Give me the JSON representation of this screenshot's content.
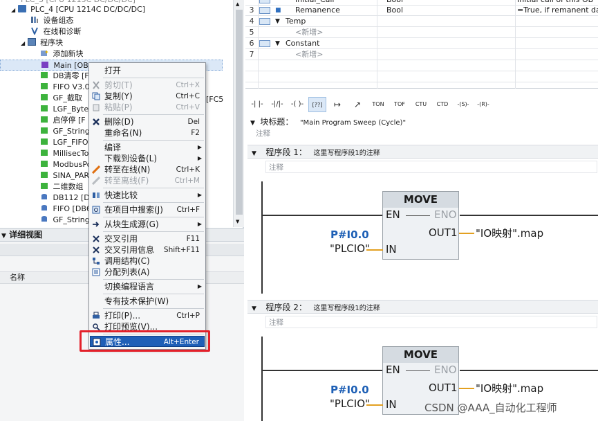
{
  "tree": {
    "items": [
      {
        "label": "PLC_4 [CPU 1214C DC/DC/DC]"
      },
      {
        "label": "设备组态"
      },
      {
        "label": "在线和诊断"
      },
      {
        "label": "程序块"
      },
      {
        "label": "添加新块"
      },
      {
        "label": "Main [OB1]"
      },
      {
        "label": "DB清零 [F"
      },
      {
        "label": "FIFO V3.0"
      },
      {
        "label": "GF_截取"
      },
      {
        "label": "LGF_Byte_"
      },
      {
        "label": "启停停 [F"
      },
      {
        "label": "GF_String_"
      },
      {
        "label": "LGF_FIFO"
      },
      {
        "label": "MillisecTo"
      },
      {
        "label": "ModbusPo"
      },
      {
        "label": "SINA_PARA"
      },
      {
        "label": "二维数组"
      },
      {
        "label": "DB112 [DB"
      },
      {
        "label": "FIFO [DB6"
      },
      {
        "label": "GF_String"
      }
    ],
    "partial_right": "[FC5"
  },
  "detail_view": {
    "title": "详细视图",
    "column_name": "名称"
  },
  "context_menu": {
    "items": [
      {
        "label": "打开",
        "shortcut": "",
        "icon": "none",
        "disabled": false,
        "submenu": false
      },
      {
        "label": "剪切(T)",
        "shortcut": "Ctrl+X",
        "icon": "cut-icon",
        "disabled": true,
        "submenu": false
      },
      {
        "label": "复制(Y)",
        "shortcut": "Ctrl+C",
        "icon": "copy-icon",
        "disabled": false,
        "submenu": false
      },
      {
        "label": "粘贴(P)",
        "shortcut": "Ctrl+V",
        "icon": "paste-icon",
        "disabled": true,
        "submenu": false
      },
      {
        "label": "删除(D)",
        "shortcut": "Del",
        "icon": "delete-icon",
        "disabled": false,
        "submenu": false
      },
      {
        "label": "重命名(N)",
        "shortcut": "F2",
        "icon": "none",
        "disabled": false,
        "submenu": false
      },
      {
        "label": "编译",
        "shortcut": "",
        "icon": "none",
        "disabled": false,
        "submenu": true
      },
      {
        "label": "下载到设备(L)",
        "shortcut": "",
        "icon": "none",
        "disabled": false,
        "submenu": true
      },
      {
        "label": "转至在线(N)",
        "shortcut": "Ctrl+K",
        "icon": "go-online-icon",
        "disabled": false,
        "submenu": false
      },
      {
        "label": "转至离线(F)",
        "shortcut": "Ctrl+M",
        "icon": "go-offline-icon",
        "disabled": true,
        "submenu": false
      },
      {
        "label": "快速比较",
        "shortcut": "",
        "icon": "compare-icon",
        "disabled": false,
        "submenu": true
      },
      {
        "label": "在项目中搜索(J)",
        "shortcut": "Ctrl+F",
        "icon": "search-icon",
        "disabled": false,
        "submenu": false
      },
      {
        "label": "从块生成源(G)",
        "shortcut": "",
        "icon": "generate-source-icon",
        "disabled": false,
        "submenu": true
      },
      {
        "label": "交叉引用",
        "shortcut": "F11",
        "icon": "cross-reference-icon",
        "disabled": false,
        "submenu": false
      },
      {
        "label": "交叉引用信息",
        "shortcut": "Shift+F11",
        "icon": "cross-reference-info-icon",
        "disabled": false,
        "submenu": false
      },
      {
        "label": "调用结构(C)",
        "shortcut": "",
        "icon": "call-structure-icon",
        "disabled": false,
        "submenu": false
      },
      {
        "label": "分配列表(A)",
        "shortcut": "",
        "icon": "assignment-list-icon",
        "disabled": false,
        "submenu": false
      },
      {
        "label": "切换编程语言",
        "shortcut": "",
        "icon": "none",
        "disabled": false,
        "submenu": true
      },
      {
        "label": "专有技术保护(W)",
        "shortcut": "",
        "icon": "none",
        "disabled": false,
        "submenu": false
      },
      {
        "label": "打印(P)...",
        "shortcut": "Ctrl+P",
        "icon": "print-icon",
        "disabled": false,
        "submenu": false
      },
      {
        "label": "打印预览(V)...",
        "shortcut": "",
        "icon": "print-preview-icon",
        "disabled": false,
        "submenu": false
      },
      {
        "label": "属性...",
        "shortcut": "Alt+Enter",
        "icon": "properties-icon",
        "disabled": false,
        "submenu": false,
        "highlighted": true
      }
    ]
  },
  "interface_table": {
    "rows": [
      {
        "no": "",
        "name": "Initial_Call",
        "type": "Bool",
        "comment": "Initial call of this OB"
      },
      {
        "no": "3",
        "name": "Remanence",
        "type": "Bool",
        "comment": "=True, if remanent data ar"
      },
      {
        "no": "4",
        "name": "Temp",
        "type": "",
        "comment": ""
      },
      {
        "no": "5",
        "name": "<新增>",
        "type": "",
        "comment": ""
      },
      {
        "no": "6",
        "name": "Constant",
        "type": "",
        "comment": ""
      },
      {
        "no": "7",
        "name": "<新增>",
        "type": "",
        "comment": ""
      },
      {
        "no": "",
        "name": "",
        "type": "",
        "comment": ""
      },
      {
        "no": "",
        "name": "",
        "type": "",
        "comment": ""
      }
    ]
  },
  "toolbar": {
    "buttons": [
      "-| |-",
      "-|/|-",
      "-( )-",
      "[??]",
      "↦",
      "↗",
      "TON",
      "TOF",
      "CTU",
      "CTD",
      "-(S)-",
      "-(R)-"
    ]
  },
  "block": {
    "title_label": "块标题：",
    "title_value": "\"Main Program Sweep (Cycle)\"",
    "comment": "注释"
  },
  "networks": [
    {
      "label": "程序段 1：",
      "comment_title": "这里写程序段1的注释",
      "comment": "注释",
      "box": {
        "name": "MOVE",
        "en": "EN",
        "eno": "ENO",
        "in": "IN",
        "out": "OUT1",
        "in_addr": "P#I0.0",
        "in_tag": "\"PLCIO\"",
        "out_tag": "\"IO映射\".map"
      }
    },
    {
      "label": "程序段 2：",
      "comment_title": "这里写程序段1的注释",
      "comment": "注释",
      "box": {
        "name": "MOVE",
        "en": "EN",
        "eno": "ENO",
        "in": "IN",
        "out": "OUT1",
        "in_addr": "P#I0.0",
        "in_tag": "\"PLCIO\"",
        "out_tag": "\"IO映射\".map"
      }
    }
  ],
  "watermark": "CSDN @AAA_自动化工程师",
  "colors": {
    "menu_highlight": "#1f5fb7",
    "annotation_red": "#e3202a",
    "tag_blue": "#1d5fb5"
  }
}
